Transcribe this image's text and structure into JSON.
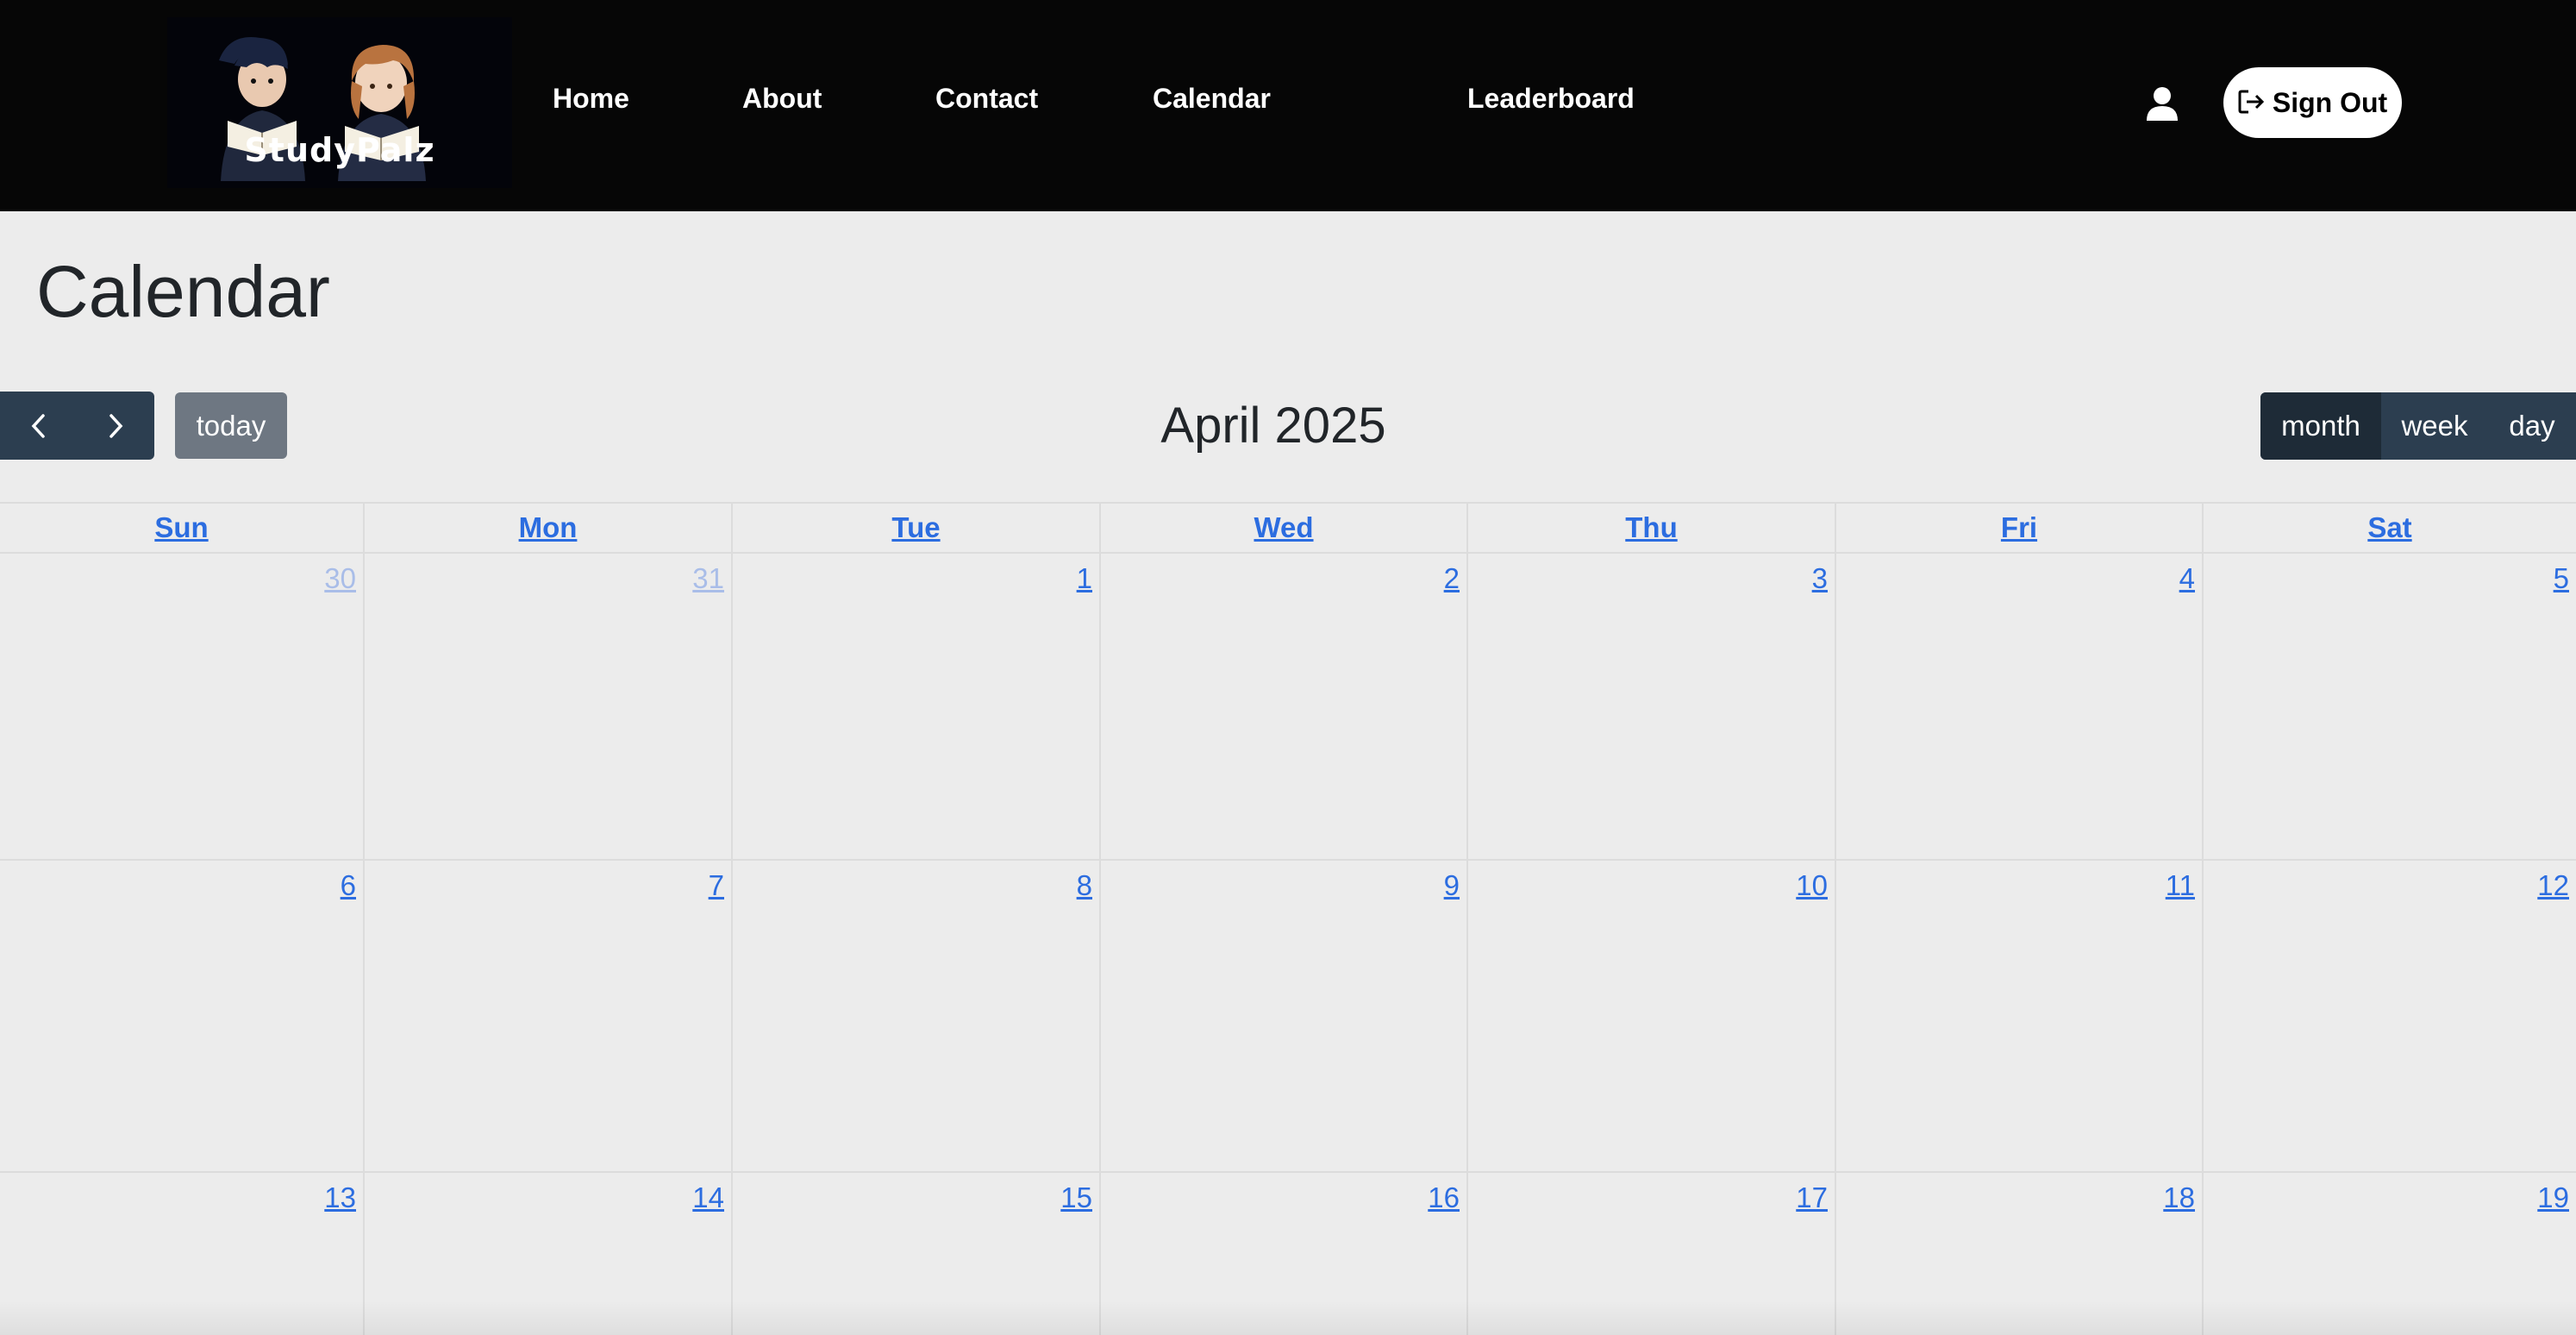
{
  "brand": {
    "logo_text": "StudyPalz"
  },
  "nav": {
    "links": [
      {
        "label": "Home"
      },
      {
        "label": "About"
      },
      {
        "label": "Contact"
      },
      {
        "label": "Calendar"
      },
      {
        "label": "Leaderboard"
      }
    ],
    "user_icon": "user-icon",
    "sign_out_label": "Sign Out",
    "sign_out_icon": "sign-out-icon"
  },
  "page": {
    "title": "Calendar"
  },
  "toolbar": {
    "prev_icon": "chevron-left-icon",
    "next_icon": "chevron-right-icon",
    "today_label": "today",
    "title": "April 2025",
    "views": [
      {
        "label": "month",
        "active": true
      },
      {
        "label": "week",
        "active": false
      },
      {
        "label": "day",
        "active": false
      }
    ]
  },
  "calendar": {
    "weekdays": [
      "Sun",
      "Mon",
      "Tue",
      "Wed",
      "Thu",
      "Fri",
      "Sat"
    ],
    "weeks": [
      {
        "days": [
          {
            "num": "30",
            "other": true
          },
          {
            "num": "31",
            "other": true
          },
          {
            "num": "1",
            "other": false
          },
          {
            "num": "2",
            "other": false
          },
          {
            "num": "3",
            "other": false
          },
          {
            "num": "4",
            "other": false
          },
          {
            "num": "5",
            "other": false
          }
        ]
      },
      {
        "days": [
          {
            "num": "6",
            "other": false
          },
          {
            "num": "7",
            "other": false
          },
          {
            "num": "8",
            "other": false
          },
          {
            "num": "9",
            "other": false
          },
          {
            "num": "10",
            "other": false
          },
          {
            "num": "11",
            "other": false
          },
          {
            "num": "12",
            "other": false
          }
        ]
      },
      {
        "days": [
          {
            "num": "13",
            "other": false
          },
          {
            "num": "14",
            "other": false
          },
          {
            "num": "15",
            "other": false
          },
          {
            "num": "16",
            "other": false
          },
          {
            "num": "17",
            "other": false
          },
          {
            "num": "18",
            "other": false
          },
          {
            "num": "19",
            "other": false
          }
        ]
      }
    ]
  },
  "colors": {
    "navbar_bg": "#060606",
    "page_bg": "#ececec",
    "button_dark": "#2c3e50",
    "button_active": "#1e2b37",
    "today_button": "#6e7782",
    "link_blue": "#2c6de0",
    "other_month": "#a9bde8"
  }
}
